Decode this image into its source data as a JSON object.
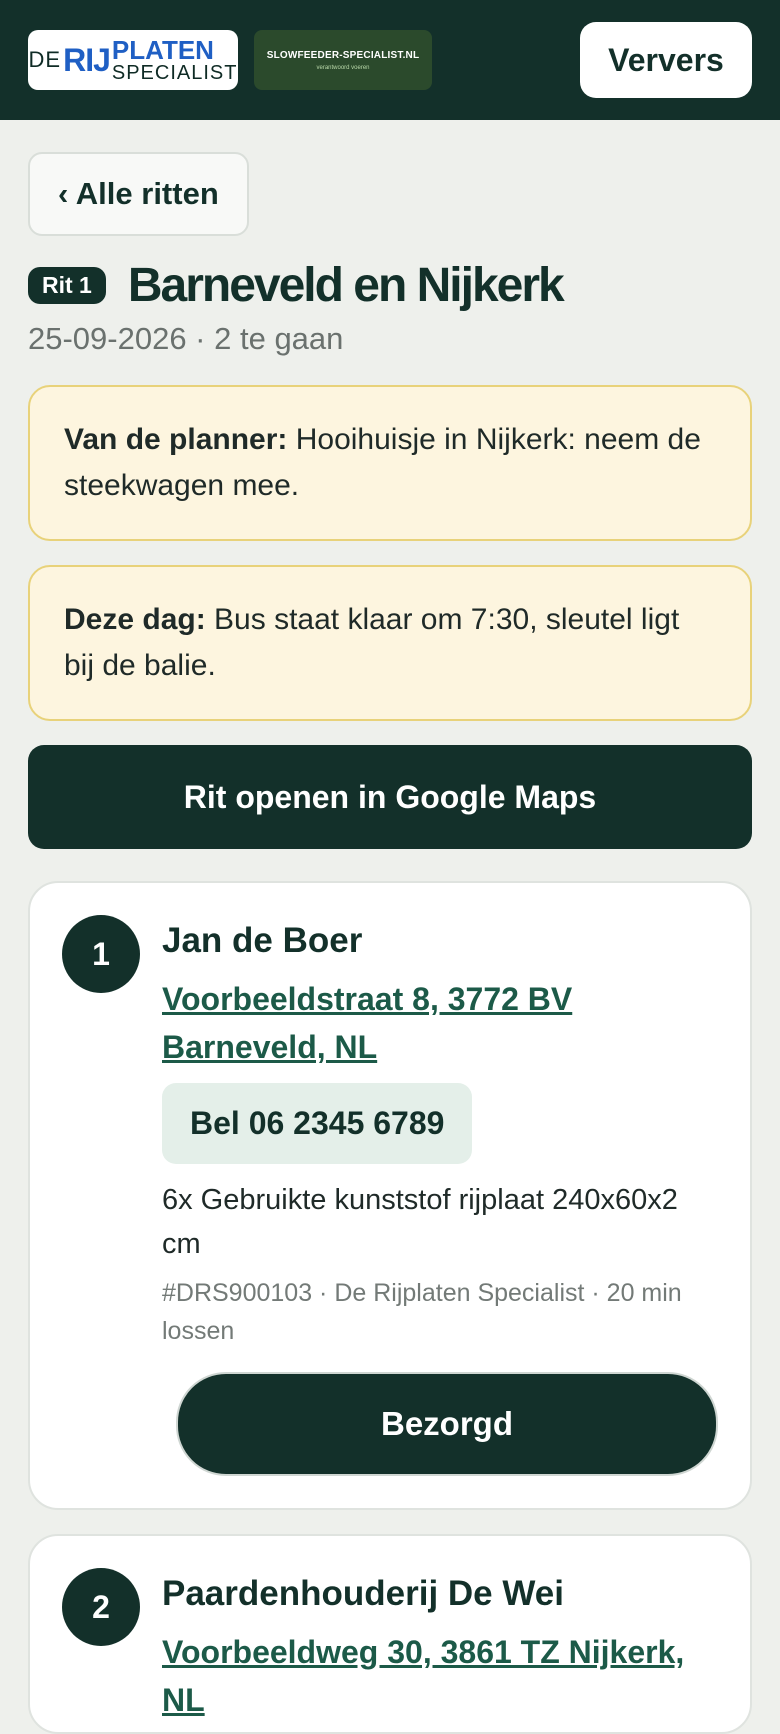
{
  "header": {
    "logo_main": {
      "de": "DE",
      "rij": "RIJ",
      "platen": "PLATEN",
      "specialist": "SPECIALIST"
    },
    "logo_secondary": {
      "title": "SLOWFEEDER-SPECIALIST.NL",
      "tagline": "verantwoord voeren"
    },
    "refresh_label": "Ververs"
  },
  "back_label": "‹ Alle ritten",
  "route": {
    "badge": "Rit 1",
    "title": "Barneveld en Nijkerk",
    "subtitle": "25-09-2026 · 2 te gaan"
  },
  "notes": [
    {
      "label": "Van de planner:",
      "text": " Hooihuisje in Nijkerk: neem de steekwagen mee."
    },
    {
      "label": "Deze dag:",
      "text": " Bus staat klaar om 7:30, sleutel ligt bij de balie."
    }
  ],
  "maps_button": "Rit openen in Google Maps",
  "stops": [
    {
      "number": "1",
      "name": "Jan de Boer",
      "address": "Voorbeeldstraat 8, 3772 BV Barneveld, NL",
      "call_label": "Bel 06 2345 6789",
      "items": "6x Gebruikte kunststof rijplaat 240x60x2 cm",
      "meta": "#DRS900103 · De Rijplaten Specialist · 20 min lossen",
      "done_label": "Bezorgd"
    },
    {
      "number": "2",
      "name": "Paardenhouderij De Wei",
      "address": "Voorbeeldweg 30, 3861 TZ Nijkerk, NL"
    }
  ],
  "colors": {
    "primary": "#13302a",
    "note_bg": "#fdf5df",
    "link": "#1c5a48",
    "brand_blue": "#1f5fc4"
  }
}
